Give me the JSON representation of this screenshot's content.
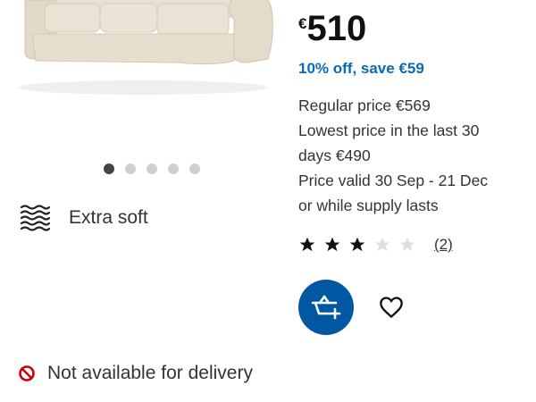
{
  "product": {
    "image_icon": "sofa-image",
    "carousel": {
      "count": 5,
      "active": 0
    },
    "feature": {
      "icon": "wave-lines-icon",
      "label": "Extra soft"
    }
  },
  "price": {
    "currency": "€",
    "amount": "510",
    "discount_text": "10% off, save €59",
    "regular": "Regular price €569",
    "lowest_line1": "Lowest price in the last 30",
    "lowest_line2": "days €490",
    "valid_line1": "Price valid 30 Sep - 21 Dec",
    "valid_line2": "or while supply lasts"
  },
  "rating": {
    "stars": 3,
    "max": 5,
    "reviews": "(2)"
  },
  "actions": {
    "cart_icon": "add-to-cart-icon",
    "favorite_icon": "heart-icon"
  },
  "availability": {
    "icon": "not-allowed-icon",
    "label": "Not available for delivery"
  },
  "colors": {
    "accent": "#0058a3",
    "discount": "#0a6ab5",
    "unavailable": "#cc0008"
  }
}
